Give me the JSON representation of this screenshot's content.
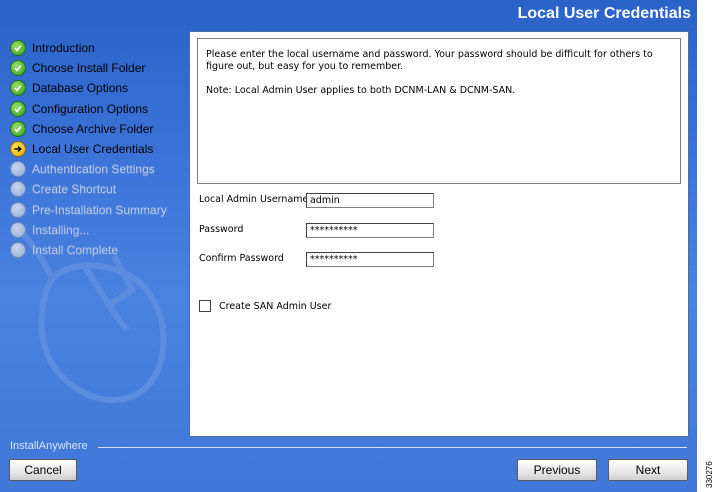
{
  "header": {
    "title": "Local User Credentials"
  },
  "steps": [
    {
      "label": "Introduction",
      "status": "done"
    },
    {
      "label": "Choose Install Folder",
      "status": "done"
    },
    {
      "label": "Database Options",
      "status": "done"
    },
    {
      "label": "Configuration Options",
      "status": "done"
    },
    {
      "label": "Choose Archive Folder",
      "status": "done"
    },
    {
      "label": "Local User Credentials",
      "status": "current"
    },
    {
      "label": "Authentication Settings",
      "status": "pending"
    },
    {
      "label": "Create Shortcut",
      "status": "pending"
    },
    {
      "label": "Pre-Installation Summary",
      "status": "pending"
    },
    {
      "label": "Installing...",
      "status": "pending"
    },
    {
      "label": "Install Complete",
      "status": "pending"
    }
  ],
  "message": {
    "line1": "Please enter the local username and password. Your password should be difficult for others to figure out, but easy for you to remember.",
    "line2": "Note: Local Admin User applies to both DCNM-LAN & DCNM-SAN."
  },
  "form": {
    "username_label": "Local Admin Username",
    "username_value": "admin",
    "password_label": "Password",
    "password_value": "**********",
    "confirm_label": "Confirm Password",
    "confirm_value": "**********",
    "san_checkbox_label": "Create  SAN Admin User",
    "san_checkbox_checked": false
  },
  "footer": {
    "brand": "InstallAnywhere",
    "cancel": "Cancel",
    "previous": "Previous",
    "next": "Next"
  },
  "figure_id": "330276",
  "colors": {
    "background": "#3a72d8",
    "done_icon": "#2e9a1c",
    "current_icon": "#e0a800",
    "pending_text": "#b9cbeb"
  }
}
